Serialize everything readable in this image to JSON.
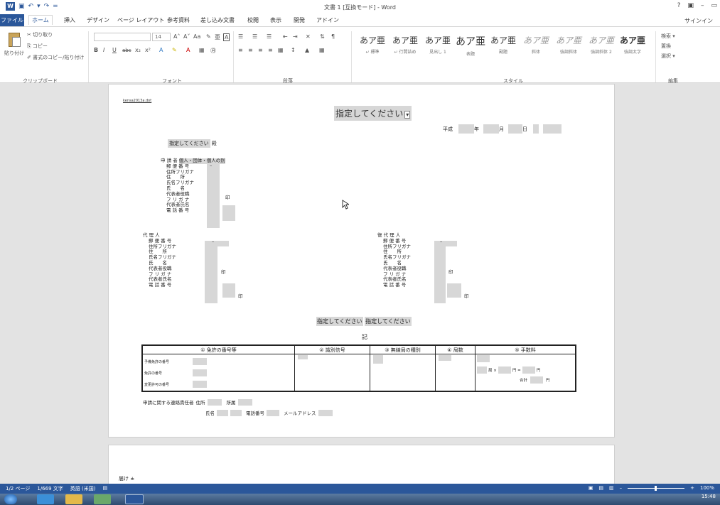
{
  "app": {
    "window_title": "文書 1 [互換モード] - Word",
    "sign_in": "サインイン",
    "help": "?",
    "ribbon_display": "▣",
    "minimize": "–",
    "restore": "▭"
  },
  "qat": {
    "save_icon": "floppy-icon",
    "undo": "↶",
    "undo_menu": "▾",
    "redo": "↷",
    "customize": "="
  },
  "tabs": [
    "ファイル",
    "ホーム",
    "挿入",
    "デザイン",
    "ページ レイアウト",
    "参考資料",
    "差し込み文書",
    "校閲",
    "表示",
    "開発",
    "アドイン"
  ],
  "ribbon": {
    "clipboard": {
      "paste": "貼り付け",
      "cut": "✂ 切り取り",
      "copy": "⎘ コピー",
      "format_painter": "✐ 書式のコピー/貼り付け",
      "label": "クリップボード"
    },
    "font": {
      "font_name": "",
      "font_size": "14",
      "grow": "A˄",
      "shrink": "A˅",
      "case": "Aa",
      "clear": "✎",
      "phonetic": "亜",
      "border": "A",
      "bold": "B",
      "italic": "I",
      "underline": "U",
      "strike": "abc",
      "sub": "x₂",
      "sup": "x²",
      "effects": "A",
      "highlight": "✎",
      "color": "A",
      "shade": "▦",
      "enclose": "㊊",
      "label": "フォント"
    },
    "paragraph": {
      "bullets": "☰",
      "numbering": "☰",
      "multilevel": "☰",
      "dec_indent": "⇤",
      "inc_indent": "⇥",
      "asian_layout": "✕",
      "sort": "⇅",
      "marks": "¶",
      "align_left": "≡",
      "center": "≡",
      "align_right": "≡",
      "justify": "≡",
      "distributed": "▦",
      "line_spacing": "↕",
      "shading": "▲",
      "borders": "▦",
      "label": "段落"
    },
    "styles": {
      "items": [
        {
          "sample": "あア亜",
          "name": "↵ 標準"
        },
        {
          "sample": "あア亜",
          "name": "↵ 行間詰め"
        },
        {
          "sample": "あア亜",
          "name": "見出し 1"
        },
        {
          "sample": "あア亜",
          "name": "表題"
        },
        {
          "sample": "あア亜",
          "name": "副題"
        },
        {
          "sample": "あア亜",
          "name": "斜体"
        },
        {
          "sample": "あア亜",
          "name": "強調斜体"
        },
        {
          "sample": "あア亜",
          "name": "強調斜体 2"
        },
        {
          "sample": "あア亜",
          "name": "強調太字"
        }
      ],
      "label": "スタイル"
    },
    "editing": {
      "find": "検索 ▾",
      "replace": "置換",
      "select": "選択 ▾",
      "label": "編集"
    }
  },
  "document": {
    "file_ref": "kensa2013a.dot",
    "title_field": "指定してください",
    "title_arrow": "▾",
    "date": {
      "era": "平成",
      "year_label": "年",
      "month_label": "月",
      "day_label": "日"
    },
    "addressee_field": "指定してください",
    "addressee_suffix": "殿",
    "applicant": {
      "header": "申 請 者",
      "header_field": "個人・団体・個人の別",
      "labels": [
        "郵 便 番 号",
        "住所フリガナ",
        "住　　所",
        "氏名フリガナ",
        "氏　　名",
        "代表者役職",
        "フ リ ガ ナ",
        "代表者氏名",
        "電 話 番 号"
      ],
      "postal_dash": "–",
      "seal": "印"
    },
    "agent": {
      "header": "代 理 人",
      "labels": [
        "郵 便 番 号",
        "住所フリガナ",
        "住　　所",
        "氏名フリガナ",
        "氏　　名",
        "代表者役職",
        "フ リ ガ ナ",
        "代表者氏名",
        "電 話 番 号"
      ],
      "postal_dash": "–",
      "seal": "印",
      "seal2": "印"
    },
    "sub_agent": {
      "header": "復 代 理 人",
      "labels": [
        "郵 便 番 号",
        "住所フリガナ",
        "住　　所",
        "氏名フリガナ",
        "氏　　名",
        "代表者役職",
        "フ リ ガ ナ",
        "代表者氏名",
        "電 話 番 号"
      ],
      "postal_dash": "–",
      "seal": "印",
      "seal2": "印"
    },
    "middle_field_1": "指定してください",
    "middle_field_2": "指定してください",
    "ki": "記",
    "table": {
      "headers": [
        "① 免許の番号等",
        "② 識別信号",
        "③ 無線局の種別",
        "④ 局数",
        "⑤ 手数料"
      ],
      "license_rows": [
        "予備免許の番号",
        "免許の番号",
        "変更許可の番号"
      ],
      "fee_stations": "局 ×",
      "fee_yen_eq": "円 =",
      "fee_yen": "円",
      "fee_total": "合計",
      "fee_total_yen": "円"
    },
    "contact": {
      "label": "申請に関する連絡責任者",
      "address": "住所",
      "affiliation": "所属",
      "name": "氏名",
      "phone": "電話番号",
      "email": "メールアドレス"
    },
    "page2_text": "届け ± "
  },
  "status": {
    "page": "1/2 ページ",
    "words": "1/669 文字",
    "language": "英語 (米国)",
    "zoom": "100%",
    "zoom_minus": "–",
    "zoom_plus": "+"
  },
  "taskbar": {
    "clock": "15:48"
  },
  "colors": {
    "accent": "#2b579a",
    "field_shade": "#d7d7d7"
  }
}
